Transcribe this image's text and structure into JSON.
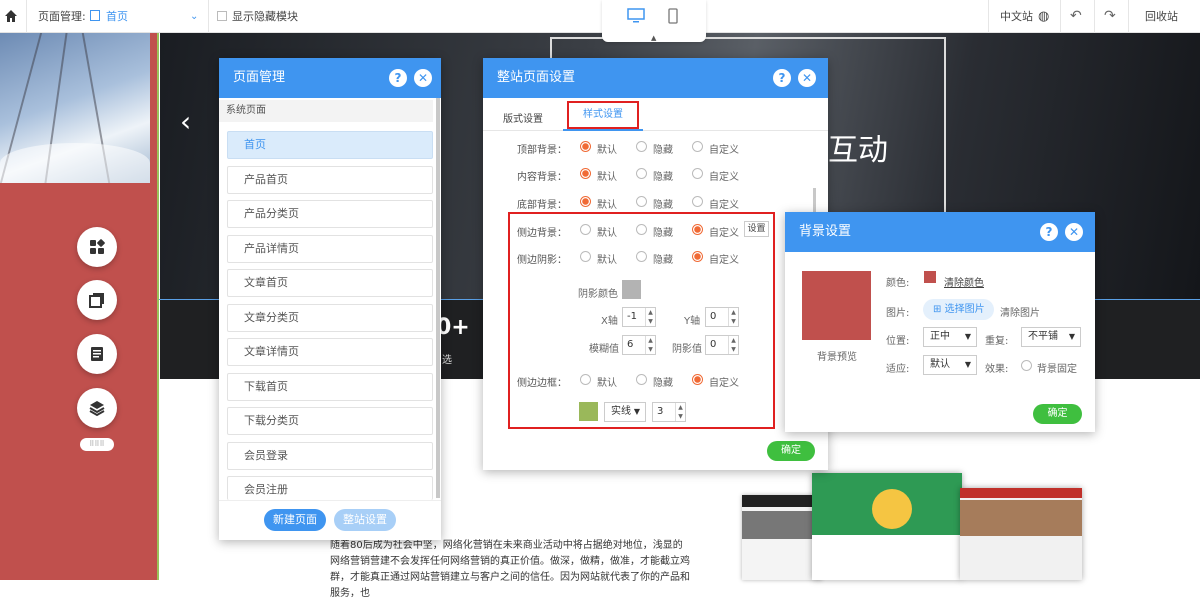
{
  "topbar": {
    "page_manage_label": "页面管理:",
    "current_page": "首页",
    "show_hidden_label": "显示隐藏模块",
    "lang_label": "中文站",
    "recycle_label": "回收站"
  },
  "site": {
    "hero_text": "互动",
    "band_number": "0+",
    "band_sub": "选",
    "paragraph": "随着80后成为社会中坚，网络化营销在未来商业活动中将占据绝对地位，浅显的网络营销营建不会发挥任何网络营销的真正价值。做深，做精，做准，才能截立鸡群，才能真正通过网站营销建立与客户之间的信任。因为网站就代表了你的产品和服务，也"
  },
  "page_manager": {
    "title": "页面管理",
    "section_label": "系统页面",
    "pages": [
      "首页",
      "产品首页",
      "产品分类页",
      "产品详情页",
      "文章首页",
      "文章分类页",
      "文章详情页",
      "下载首页",
      "下载分类页",
      "会员登录",
      "会员注册"
    ],
    "new_page_btn": "新建页面",
    "site_settings_btn": "整站设置"
  },
  "site_settings": {
    "title": "整站页面设置",
    "tabs": [
      "版式设置",
      "样式设置"
    ],
    "active_tab": 1,
    "rows": [
      {
        "label": "顶部背景：",
        "options": [
          "默认",
          "隐藏",
          "自定义"
        ],
        "selected": 0
      },
      {
        "label": "内容背景：",
        "options": [
          "默认",
          "隐藏",
          "自定义"
        ],
        "selected": 0
      },
      {
        "label": "底部背景：",
        "options": [
          "默认",
          "隐藏",
          "自定义"
        ],
        "selected": 0
      },
      {
        "label": "侧边背景：",
        "options": [
          "默认",
          "隐藏",
          "自定义"
        ],
        "selected": 2
      },
      {
        "label": "侧边阴影：",
        "options": [
          "默认",
          "隐藏",
          "自定义"
        ],
        "selected": 2
      }
    ],
    "settings_btn": "设置",
    "shadow_color_label": "阴影颜色",
    "shadow_color": "#b3b3b3",
    "x_label": "X轴",
    "x_value": "-1",
    "y_label": "Y轴",
    "y_value": "0",
    "blur_label": "模糊值",
    "blur_value": "6",
    "spread_label": "阴影值",
    "spread_value": "0",
    "border_row": {
      "label": "侧边边框：",
      "options": [
        "默认",
        "隐藏",
        "自定义"
      ],
      "selected": 2
    },
    "border_color": "#9ab85a",
    "border_style": "实线",
    "border_width": "3",
    "confirm_btn": "确定"
  },
  "bg_settings": {
    "title": "背景设置",
    "preview_label": "背景预览",
    "preview_color": "#c0504d",
    "color_label": "颜色:",
    "clear_color": "清除颜色",
    "image_label": "图片:",
    "choose_image": "选择图片",
    "clear_image": "清除图片",
    "position_label": "位置:",
    "position_value": "正中",
    "repeat_label": "重复:",
    "repeat_value": "不平铺",
    "fit_label": "适应:",
    "fit_value": "默认",
    "effect_label": "效果:",
    "fixed_label": "背景固定",
    "confirm_btn": "确定"
  },
  "colors": {
    "accent": "#3f95f0",
    "radio_selected": "#f06a35",
    "side_red": "#c0504d",
    "confirm_green": "#3fbf3f",
    "highlight_border": "#e02020"
  }
}
